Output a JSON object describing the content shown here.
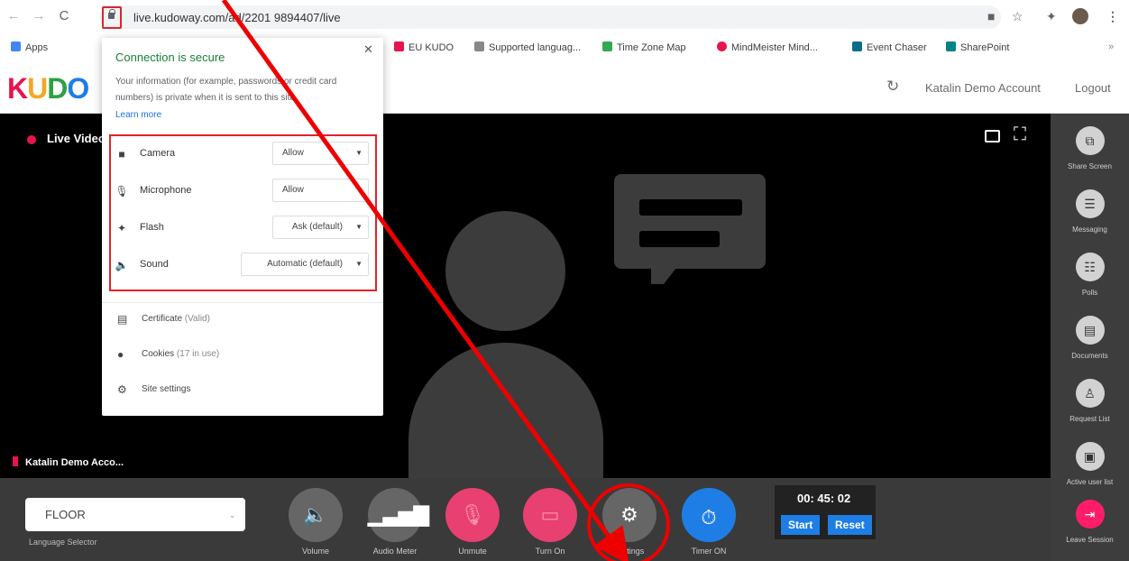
{
  "browser": {
    "url": "live.kudoway.com/ad/2201 9894407/live",
    "nav": [
      "←",
      "→",
      "C"
    ],
    "toolbar_icons": [
      "camera-icon",
      "star-icon",
      "extensions-icon",
      "profile-icon",
      "menu-icon"
    ]
  },
  "bookmarks": [
    {
      "label": "Apps",
      "color": "#4285f4"
    },
    {
      "label": "EU KUDO",
      "color": "#e8144e"
    },
    {
      "label": "Supported languag...",
      "color": "#888888"
    },
    {
      "label": "Time Zone Map",
      "color": "#34a853"
    },
    {
      "label": "MindMeister Mind...",
      "color": "#e8144e"
    },
    {
      "label": "Event Chaser",
      "color": "#0a6e8a"
    },
    {
      "label": "SharePoint",
      "color": "#038387"
    },
    {
      "label": "»",
      "color": "#ffffff"
    }
  ],
  "header": {
    "logo": "KUDO",
    "logo_colors": [
      "#e8144e",
      "#f5a623",
      "#2ea043",
      "#1e7ee6"
    ],
    "account": "Katalin Demo Account",
    "logout": "Logout"
  },
  "video": {
    "live_label": "Live Video",
    "participant_name": "Katalin Demo Acco..."
  },
  "rail": [
    {
      "label": "Share Screen",
      "icon": "share-screen-icon"
    },
    {
      "label": "Messaging",
      "icon": "message-icon"
    },
    {
      "label": "Polls",
      "icon": "polls-icon"
    },
    {
      "label": "Documents",
      "icon": "document-icon"
    },
    {
      "label": "Request List",
      "icon": "request-list-icon"
    },
    {
      "label": "Active user list",
      "icon": "user-list-icon"
    },
    {
      "label": "Leave Session",
      "icon": "leave-icon"
    }
  ],
  "controls": {
    "language_value": "FLOOR",
    "language_label": "Language Selector",
    "buttons": [
      {
        "label": "Volume",
        "color": "#666666"
      },
      {
        "label": "Audio Meter",
        "color": "#666666"
      },
      {
        "label": "Unmute",
        "color": "#e84070"
      },
      {
        "label": "Turn On",
        "color": "#e84070"
      },
      {
        "label": "Settings",
        "color": "#666666"
      },
      {
        "label": "Timer ON",
        "color": "#1e7ee6"
      }
    ],
    "timer_value": "00: 45: 02",
    "start": "Start",
    "reset": "Reset"
  },
  "popup": {
    "title": "Connection is secure",
    "description": "Your information (for example, passwords or credit card numbers) is private when it is sent to this site.",
    "learn_more": "Learn more",
    "permissions": [
      {
        "label": "Camera",
        "value": "Allow",
        "icon": "camera-icon"
      },
      {
        "label": "Microphone",
        "value": "Allow",
        "icon": "microphone-icon"
      },
      {
        "label": "Flash",
        "value": "Ask (default)",
        "icon": "puzzle-icon"
      },
      {
        "label": "Sound",
        "value": "Automatic (default)",
        "icon": "speaker-icon"
      }
    ],
    "items": [
      {
        "label": "Certificate",
        "detail": "(Valid)",
        "icon": "certificate-icon"
      },
      {
        "label": "Cookies",
        "detail": "(17 in use)",
        "icon": "cookie-icon"
      },
      {
        "label": "Site settings",
        "detail": "",
        "icon": "gear-icon"
      }
    ]
  }
}
